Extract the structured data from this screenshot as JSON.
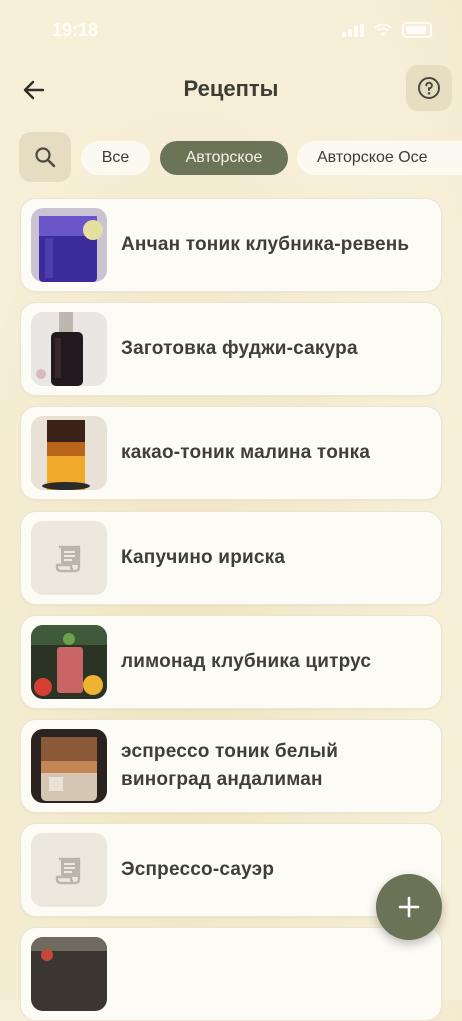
{
  "status_bar": {
    "time": "19:18"
  },
  "header": {
    "title": "Рецепты"
  },
  "filters": {
    "chips": [
      "Все",
      "Авторское",
      "Авторское Осе"
    ],
    "active_index": 1
  },
  "recipes": [
    {
      "name": "Анчан тоник клубника-ревень",
      "image": "butterfly-pea-drink-photo"
    },
    {
      "name": "Заготовка фуджи-сакура",
      "image": "bottle-syrup-photo"
    },
    {
      "name": "какао-тоник малина тонка",
      "image": "layered-drink-photo"
    },
    {
      "name": "Капучино ириска",
      "image": "recipe-placeholder-icon"
    },
    {
      "name": "лимонад клубника цитрус",
      "image": "lemonade-photo"
    },
    {
      "name": "эспрессо тоник белый виноград андалиман",
      "image": "espresso-tonic-photo"
    },
    {
      "name": "Эспрессо-сауэр",
      "image": "recipe-placeholder-icon"
    },
    {
      "name": "",
      "image": "drink-photo-partial"
    }
  ],
  "colors": {
    "accent": "#6c7456",
    "card": "#fdfbf5",
    "background": "#f5edd4"
  }
}
